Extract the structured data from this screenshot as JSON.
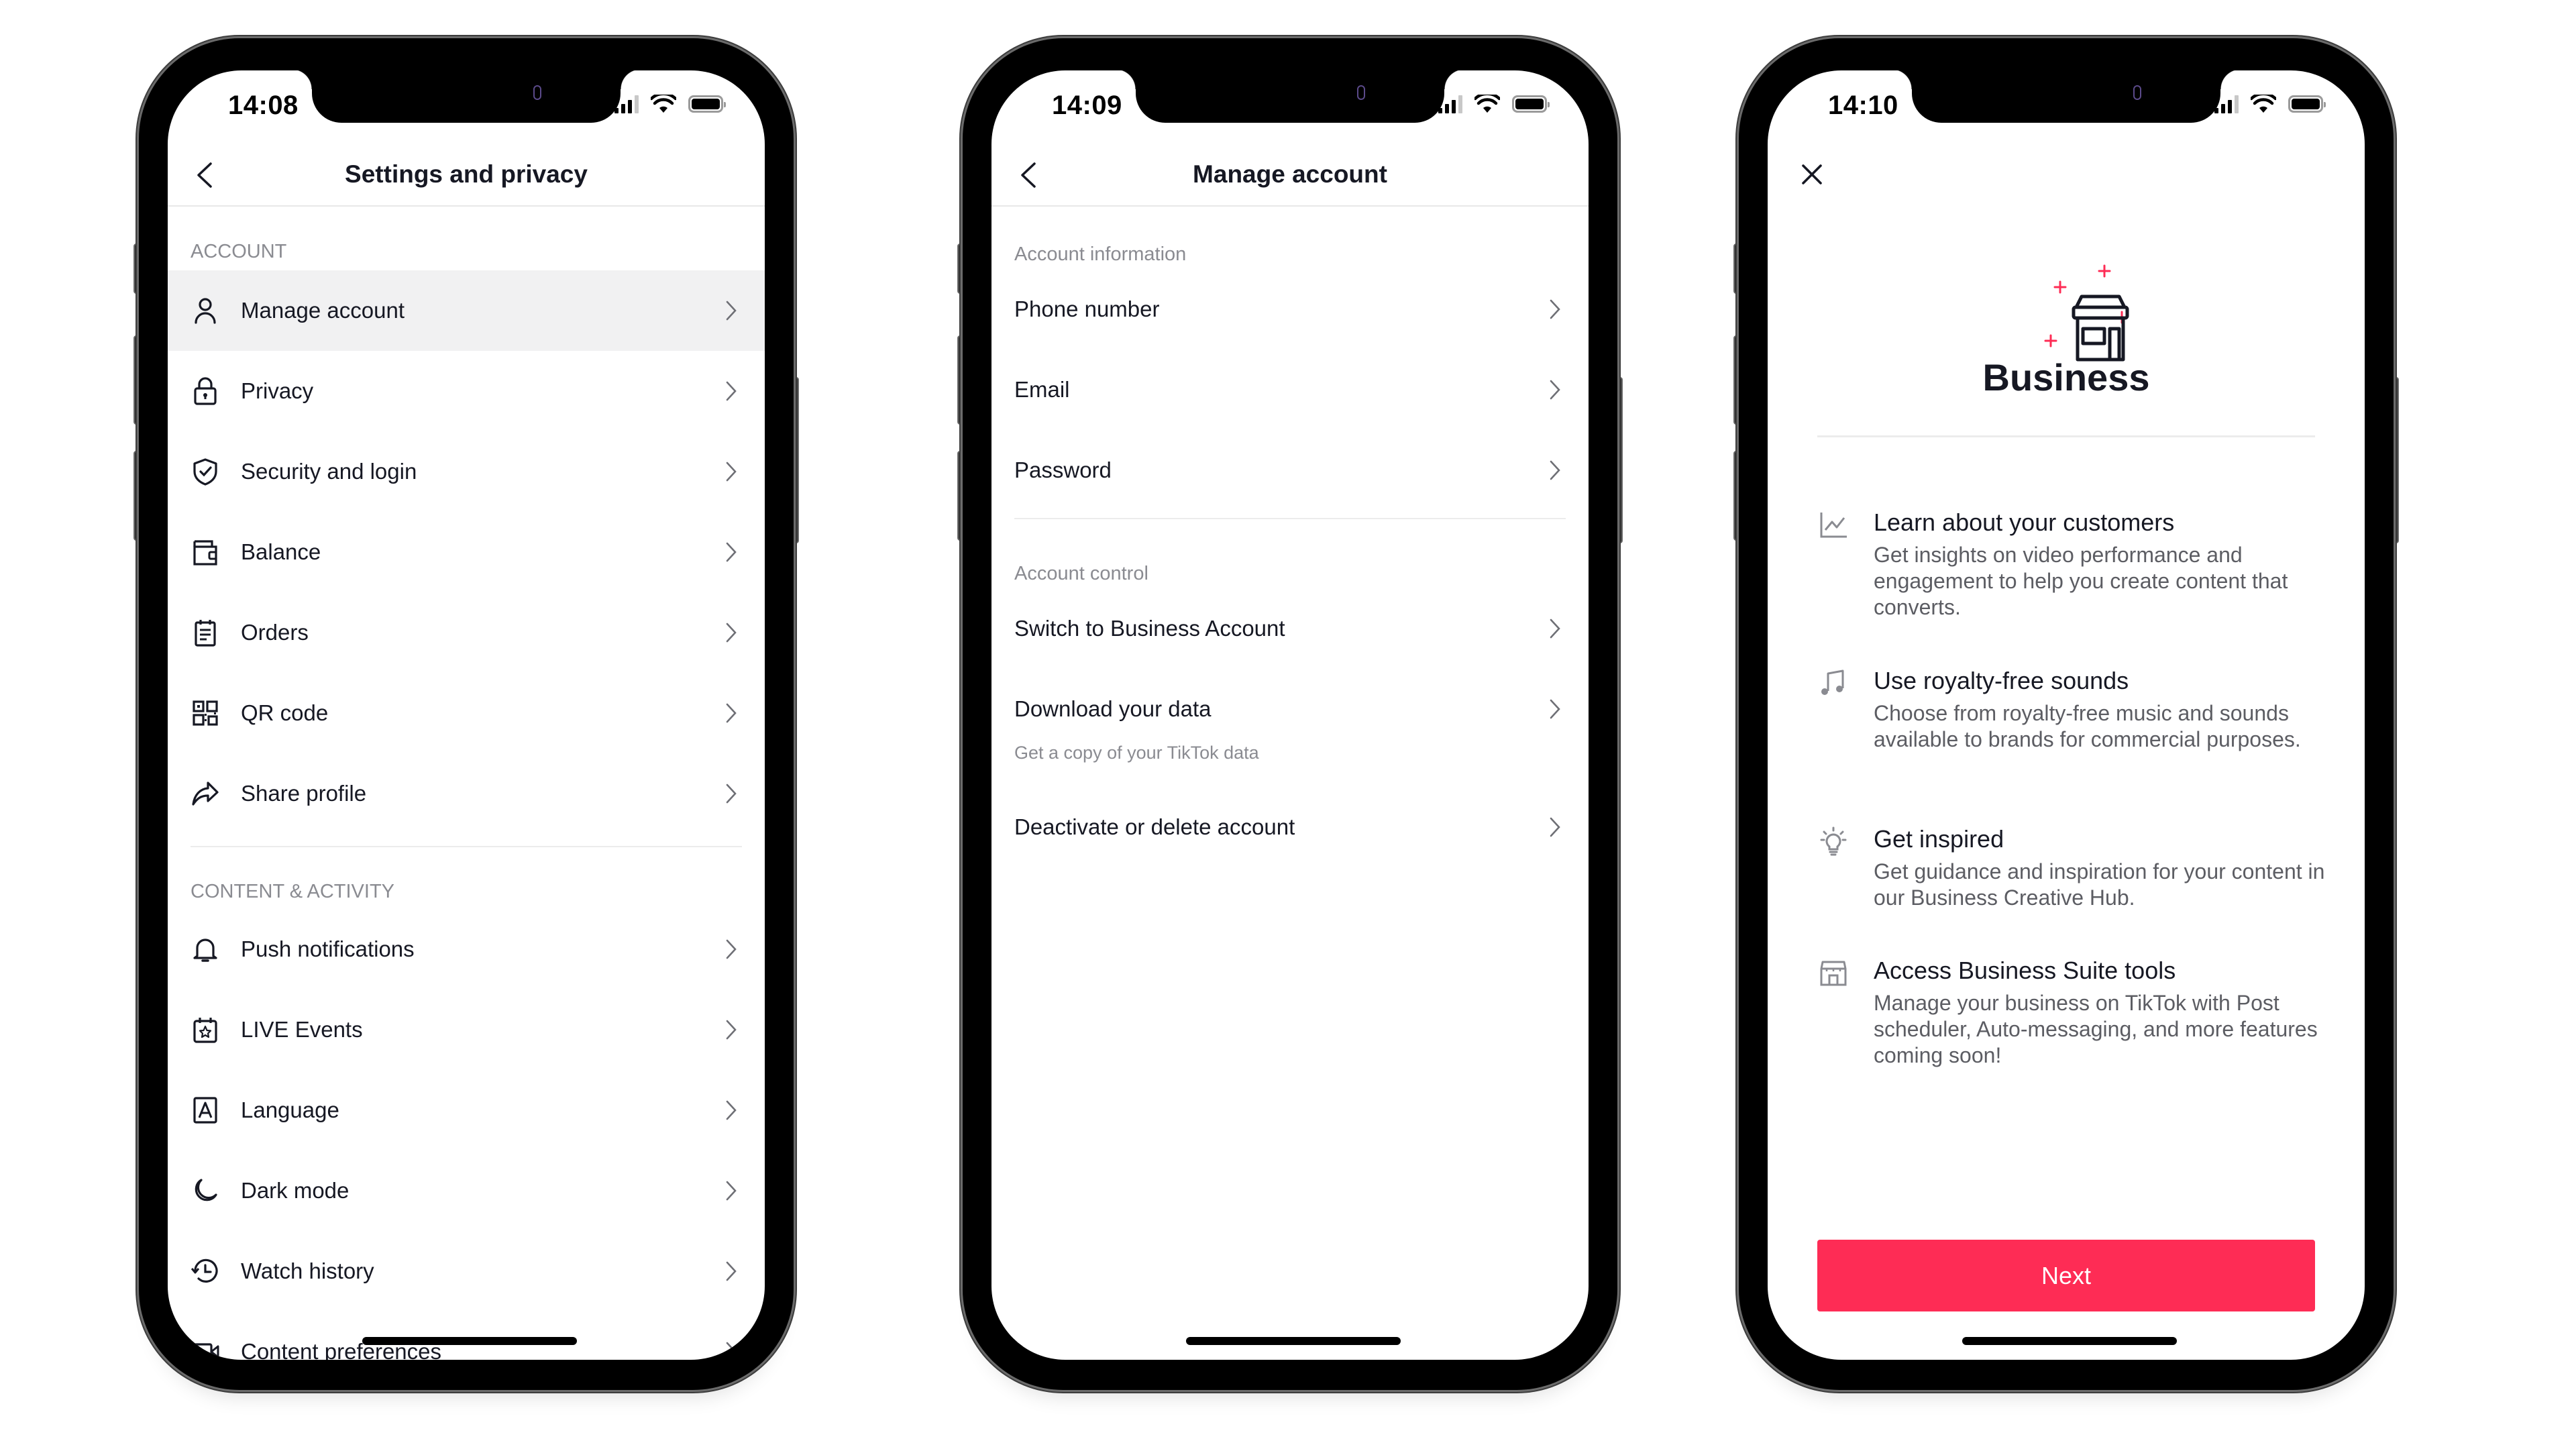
{
  "colors": {
    "accent": "#fe2c55",
    "text_primary": "#161823",
    "text_secondary": "#8a8b91",
    "row_highlight": "#f1f1f2"
  },
  "phones": [
    {
      "status": {
        "time": "14:08"
      },
      "header": {
        "title": "Settings and privacy",
        "back_icon": "chevron-left-icon"
      },
      "sections": [
        {
          "label": "ACCOUNT",
          "items": [
            {
              "label": "Manage account",
              "icon": "person-icon",
              "highlighted": true
            },
            {
              "label": "Privacy",
              "icon": "lock-icon"
            },
            {
              "label": "Security and login",
              "icon": "shield-check-icon"
            },
            {
              "label": "Balance",
              "icon": "wallet-icon"
            },
            {
              "label": "Orders",
              "icon": "clipboard-icon"
            },
            {
              "label": "QR code",
              "icon": "qr-code-icon"
            },
            {
              "label": "Share profile",
              "icon": "share-arrow-icon"
            }
          ]
        },
        {
          "label": "CONTENT & ACTIVITY",
          "items": [
            {
              "label": "Push notifications",
              "icon": "bell-icon"
            },
            {
              "label": "LIVE Events",
              "icon": "calendar-star-icon"
            },
            {
              "label": "Language",
              "icon": "language-a-icon"
            },
            {
              "label": "Dark mode",
              "icon": "moon-icon"
            },
            {
              "label": "Watch history",
              "icon": "history-clock-icon"
            },
            {
              "label": "Content preferences",
              "icon": "video-camera-icon"
            }
          ]
        }
      ]
    },
    {
      "status": {
        "time": "14:09"
      },
      "header": {
        "title": "Manage account",
        "back_icon": "chevron-left-icon"
      },
      "sections": [
        {
          "label": "Account information",
          "items": [
            {
              "label": "Phone number"
            },
            {
              "label": "Email"
            },
            {
              "label": "Password"
            }
          ]
        },
        {
          "label": "Account control",
          "items": [
            {
              "label": "Switch to Business Account"
            },
            {
              "label": "Download your data",
              "subtitle": "Get a copy of your TikTok data"
            },
            {
              "label": "Deactivate or delete account"
            }
          ]
        }
      ]
    },
    {
      "status": {
        "time": "14:10"
      },
      "close_icon": "close-icon",
      "hero": {
        "icon": "storefront-icon",
        "title": "Business"
      },
      "features": [
        {
          "icon": "line-chart-icon",
          "title": "Learn about your customers",
          "description": "Get insights on video performance and engagement to help you create content that converts."
        },
        {
          "icon": "music-note-icon",
          "title": "Use royalty-free sounds",
          "description": "Choose from royalty-free music and sounds available to brands for commercial purposes."
        },
        {
          "icon": "lightbulb-icon",
          "title": "Get inspired",
          "description": "Get guidance and inspiration for your content in our Business Creative Hub."
        },
        {
          "icon": "store-icon",
          "title": "Access Business Suite tools",
          "description": "Manage your business on TikTok with Post scheduler, Auto-messaging, and more features coming soon!"
        }
      ],
      "primary_button": {
        "label": "Next"
      }
    }
  ]
}
